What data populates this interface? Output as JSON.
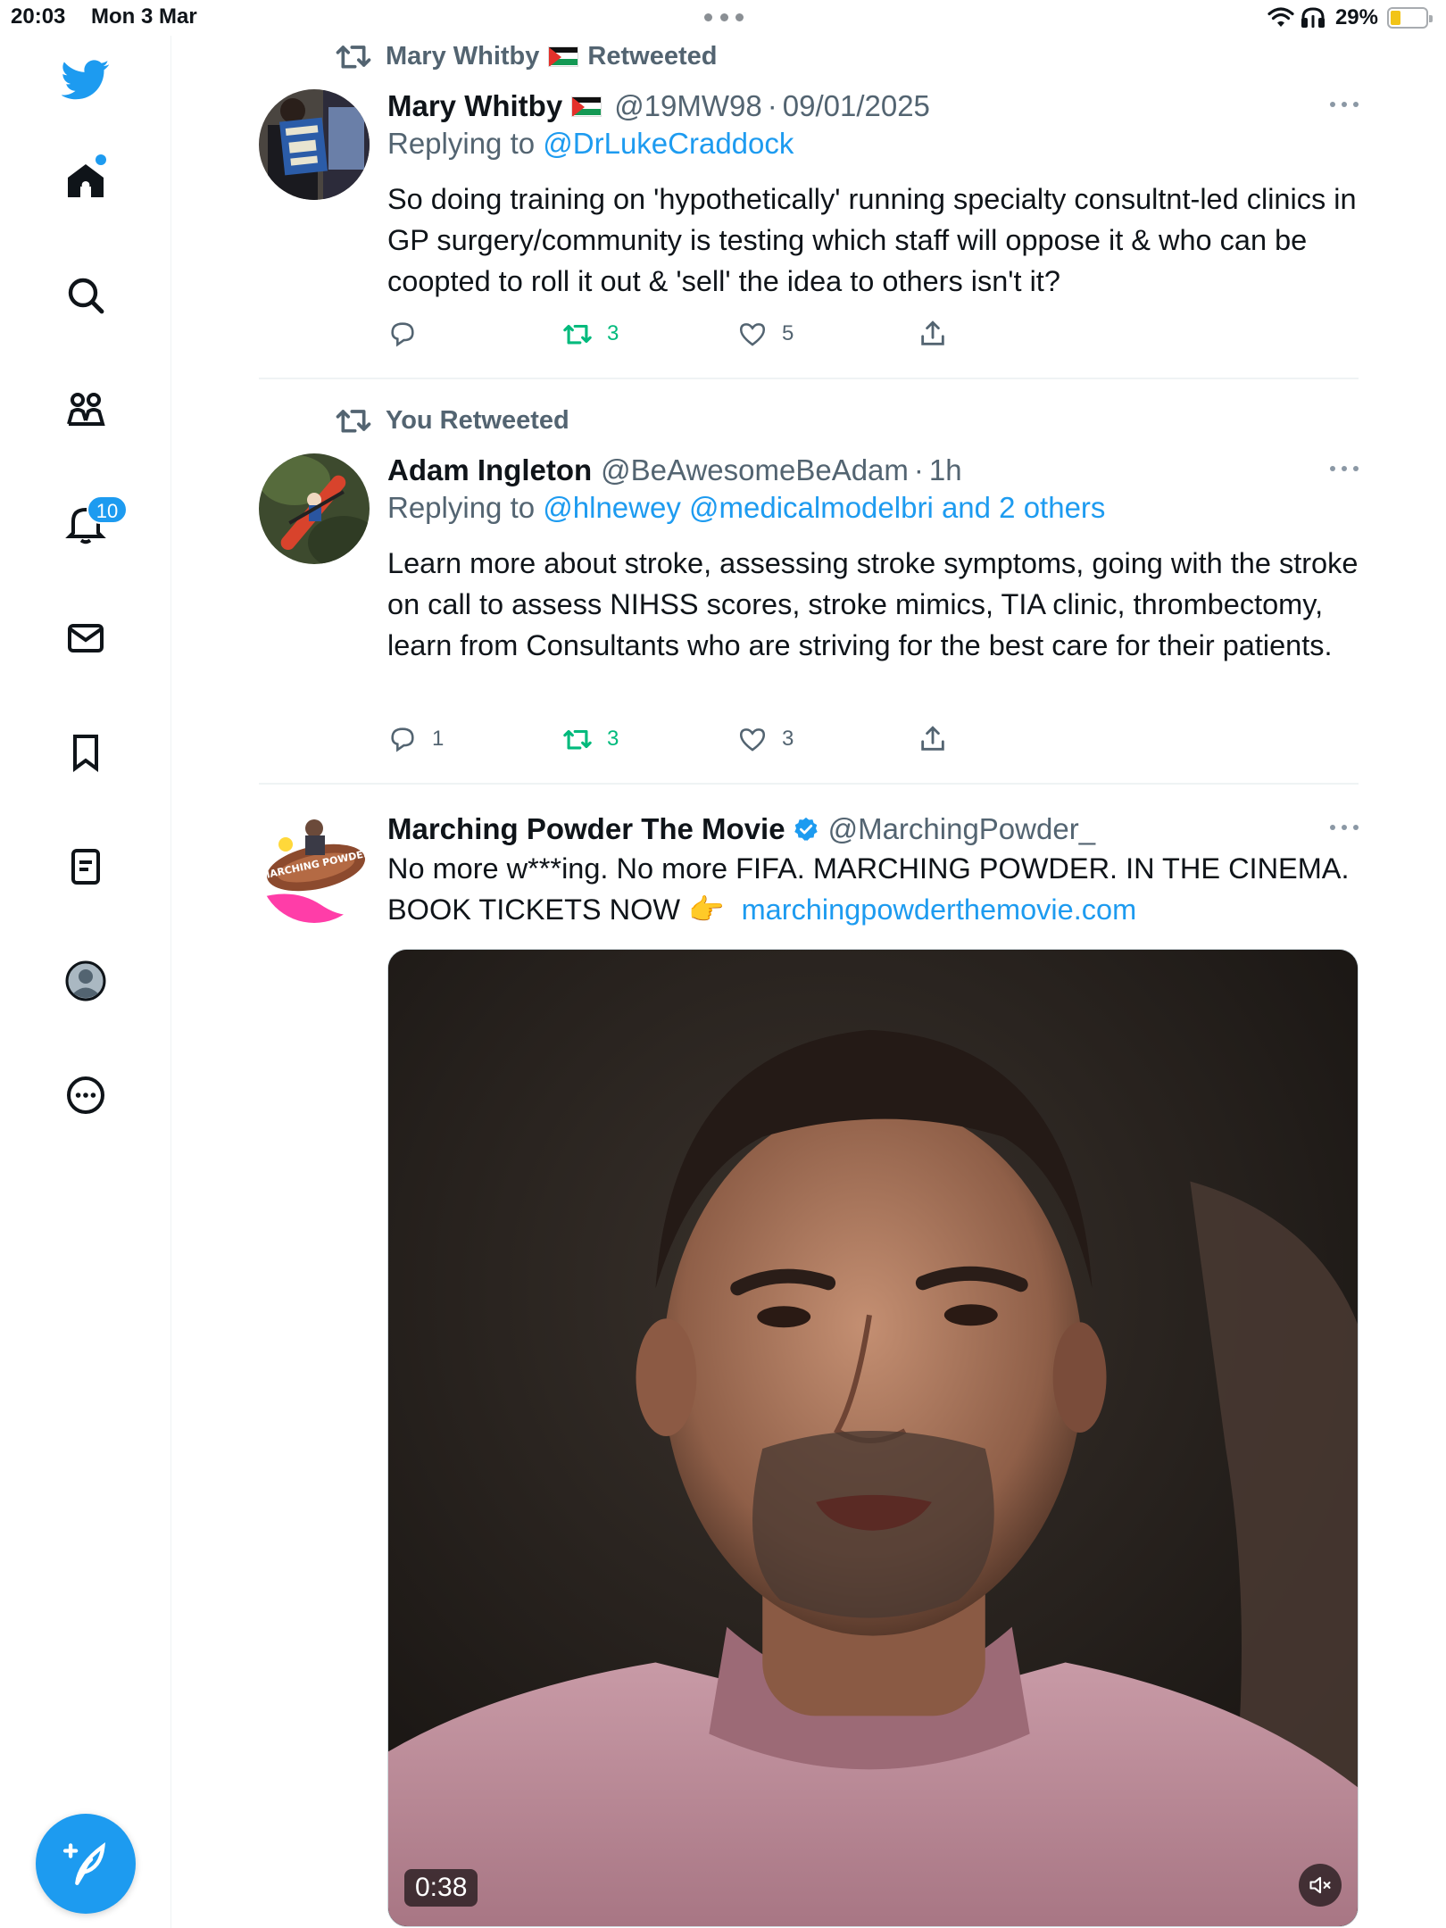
{
  "status_bar": {
    "time": "20:03",
    "date": "Mon 3 Mar",
    "battery_percent": "29%",
    "battery_level": 0.29,
    "icons": [
      "wifi-icon",
      "headphones-icon",
      "battery-icon"
    ]
  },
  "sidebar": {
    "items": [
      {
        "name": "twitter-logo",
        "icon": "bird"
      },
      {
        "name": "home",
        "icon": "home",
        "has_dot": true
      },
      {
        "name": "search",
        "icon": "magnifier"
      },
      {
        "name": "communities",
        "icon": "people"
      },
      {
        "name": "notifications",
        "icon": "bell",
        "badge": "10"
      },
      {
        "name": "messages",
        "icon": "envelope"
      },
      {
        "name": "bookmarks",
        "icon": "bookmark"
      },
      {
        "name": "lists",
        "icon": "list"
      },
      {
        "name": "profile",
        "icon": "avatar"
      },
      {
        "name": "more",
        "icon": "ellipsis-circle"
      }
    ],
    "notifications_badge": "10"
  },
  "colors": {
    "accent": "#1d9bf0",
    "secondary_text": "#536471",
    "retweet_green": "#00ba7c",
    "text": "#0f1419"
  },
  "tweets": [
    {
      "retweeted_by": "Mary Whitby",
      "retweeted_suffix": "Retweeted",
      "author_name": "Mary Whitby",
      "author_handle": "@19MW98",
      "separator": "·",
      "time": "09/01/2025",
      "replying_prefix": "Replying to ",
      "replying_to": "@DrLukeCraddock",
      "text": "So doing training on 'hypothetically' running specialty consultnt-led clinics in GP surgery/community is testing which staff will oppose it & who can be coopted to roll it out & 'sell' the idea to others isn't it?",
      "replies": "",
      "retweets": "3",
      "likes": "5"
    },
    {
      "retweeted_by": "You Retweeted",
      "author_name": "Adam Ingleton",
      "author_handle": "@BeAwesomeBeAdam",
      "separator": "·",
      "time": "1h",
      "replying_prefix": "Replying to ",
      "replying_to": "@hlnewey @medicalmodelbri and 2 others",
      "text": "Learn more about stroke, assessing stroke symptoms, going with the stroke on call to assess NIHSS scores, stroke mimics, TIA clinic, thrombectomy, learn from Consultants who are striving for the best care for their patients.",
      "replies": "1",
      "retweets": "3",
      "likes": "3"
    },
    {
      "author_name": "Marching Powder The Movie",
      "verified": true,
      "author_handle": "@MarchingPowder_",
      "text": "No more w***ing. No more FIFA. MARCHING POWDER. IN THE CINEMA. BOOK TICKETS NOW 👉",
      "link": "marchingpowderthemovie.com",
      "avatar_text": "MARCHING POWDER",
      "video_duration": "0:38"
    }
  ]
}
